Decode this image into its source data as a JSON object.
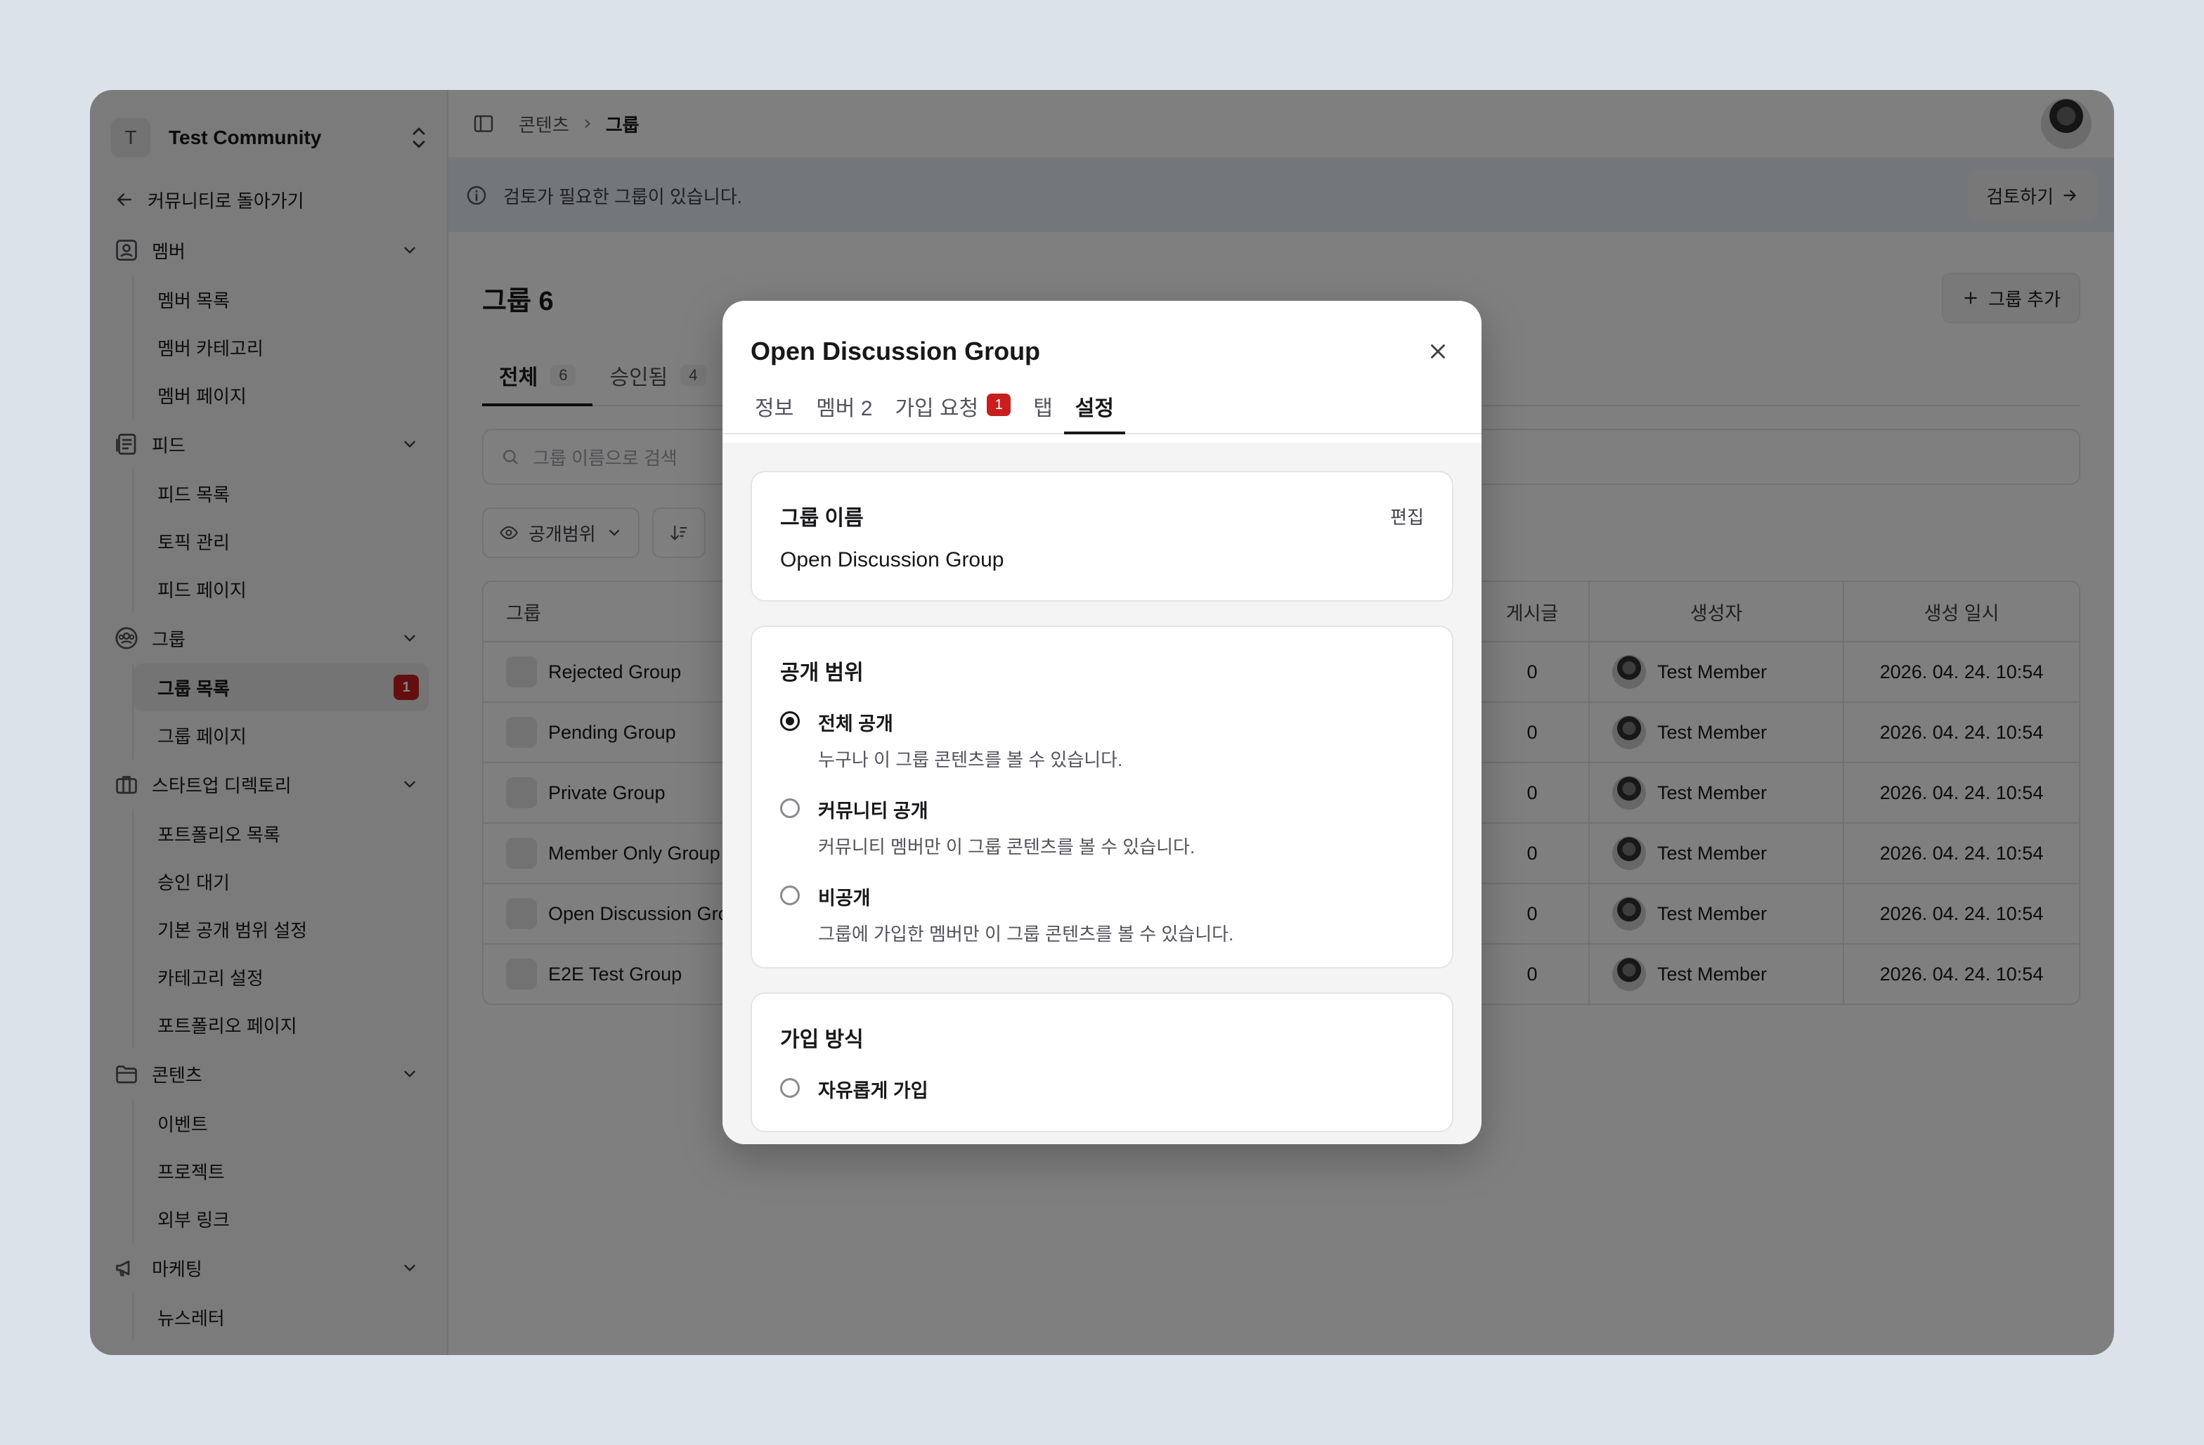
{
  "sidebar": {
    "community_initial": "T",
    "community_name": "Test Community",
    "back_label": "커뮤니티로 돌아가기",
    "groups": [
      {
        "label": "멤버",
        "items": [
          "멤버 목록",
          "멤버 카테고리",
          "멤버 페이지"
        ]
      },
      {
        "label": "피드",
        "items": [
          "피드 목록",
          "토픽 관리",
          "피드 페이지"
        ]
      },
      {
        "label": "그룹",
        "items": [
          "그룹 목록",
          "그룹 페이지"
        ],
        "badge": "1"
      },
      {
        "label": "스타트업 디렉토리",
        "items": [
          "포트폴리오 목록",
          "승인 대기",
          "기본 공개 범위 설정",
          "카테고리 설정",
          "포트폴리오 페이지"
        ]
      },
      {
        "label": "콘텐츠",
        "items": [
          "이벤트",
          "프로젝트",
          "외부 링크"
        ]
      },
      {
        "label": "마케팅",
        "items": [
          "뉴스레터"
        ]
      }
    ]
  },
  "topbar": {
    "crumb_parent": "콘텐츠",
    "crumb_current": "그룹"
  },
  "notice": {
    "text": "검토가 필요한 그룹이 있습니다.",
    "button": "검토하기"
  },
  "page": {
    "title": "그룹 6",
    "add_button": "그룹 추가",
    "tabs": [
      {
        "label": "전체",
        "count": "6"
      },
      {
        "label": "승인됨",
        "count": "4"
      }
    ],
    "search_placeholder": "그룹 이름으로 검색",
    "filters": [
      "공개범위"
    ],
    "table": {
      "headers": {
        "group": "그룹",
        "posts": "게시글",
        "creator": "생성자",
        "created": "생성 일시"
      },
      "rows": [
        {
          "name": "Rejected Group",
          "posts": "0",
          "creator": "Test Member",
          "created": "2026. 04. 24. 10:54"
        },
        {
          "name": "Pending Group",
          "posts": "0",
          "creator": "Test Member",
          "created": "2026. 04. 24. 10:54"
        },
        {
          "name": "Private Group",
          "posts": "0",
          "creator": "Test Member",
          "created": "2026. 04. 24. 10:54"
        },
        {
          "name": "Member Only Group",
          "posts": "0",
          "creator": "Test Member",
          "created": "2026. 04. 24. 10:54"
        },
        {
          "name": "Open Discussion Group",
          "posts": "0",
          "creator": "Test Member",
          "created": "2026. 04. 24. 10:54"
        },
        {
          "name": "E2E Test Group",
          "posts": "0",
          "creator": "Test Member",
          "created": "2026. 04. 24. 10:54"
        }
      ]
    }
  },
  "modal": {
    "title": "Open Discussion Group",
    "tabs": [
      {
        "label": "정보"
      },
      {
        "label": "멤버 2"
      },
      {
        "label": "가입 요청",
        "badge": "1"
      },
      {
        "label": "탭"
      },
      {
        "label": "설정"
      }
    ],
    "name_card": {
      "heading": "그룹 이름",
      "edit": "편집",
      "value": "Open Discussion Group"
    },
    "visibility_card": {
      "heading": "공개 범위",
      "options": [
        {
          "label": "전체 공개",
          "desc": "누구나 이 그룹 콘텐츠를 볼 수 있습니다.",
          "selected": true
        },
        {
          "label": "커뮤니티 공개",
          "desc": "커뮤니티 멤버만 이 그룹 콘텐츠를 볼 수 있습니다.",
          "selected": false
        },
        {
          "label": "비공개",
          "desc": "그룹에 가입한 멤버만 이 그룹 콘텐츠를 볼 수 있습니다.",
          "selected": false
        }
      ]
    },
    "join_card": {
      "heading": "가입 방식",
      "options": [
        {
          "label": "자유롭게 가입",
          "selected": false
        }
      ]
    }
  }
}
